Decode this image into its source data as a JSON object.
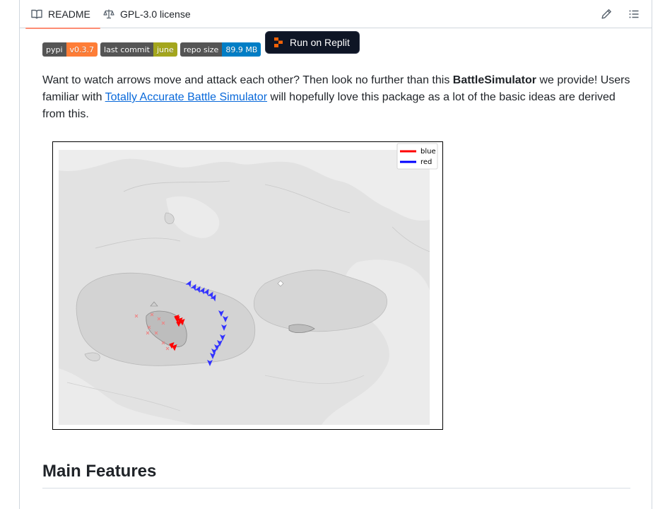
{
  "tabs": {
    "readme": "README",
    "license": "GPL-3.0 license"
  },
  "badges": [
    {
      "label": "pypi",
      "value": "v0.3.7",
      "color": "#fe7d37"
    },
    {
      "label": "last commit",
      "value": "june",
      "color": "#a4a61d"
    },
    {
      "label": "repo size",
      "value": "89.9 MB",
      "color": "#007ec6"
    }
  ],
  "replit_button": "Run on Replit",
  "intro": {
    "part1": "Want to watch arrows move and attack each other? Then look no further than this ",
    "bold": "BattleSimulator",
    "part2": " we provide! Users familiar with ",
    "link": "Totally Accurate Battle Simulator",
    "part3": " will hopefully love this package as a lot of the basic ideas are derived from this."
  },
  "figure": {
    "legend": [
      {
        "label": "blue",
        "color": "#ff0000"
      },
      {
        "label": "red",
        "color": "#0000ff"
      }
    ]
  },
  "section_heading": "Main Features",
  "colors": {
    "accent_tab": "#fd8c73",
    "link": "#0969da",
    "unit_red": "#ff0000",
    "unit_blue": "#3333ff"
  }
}
